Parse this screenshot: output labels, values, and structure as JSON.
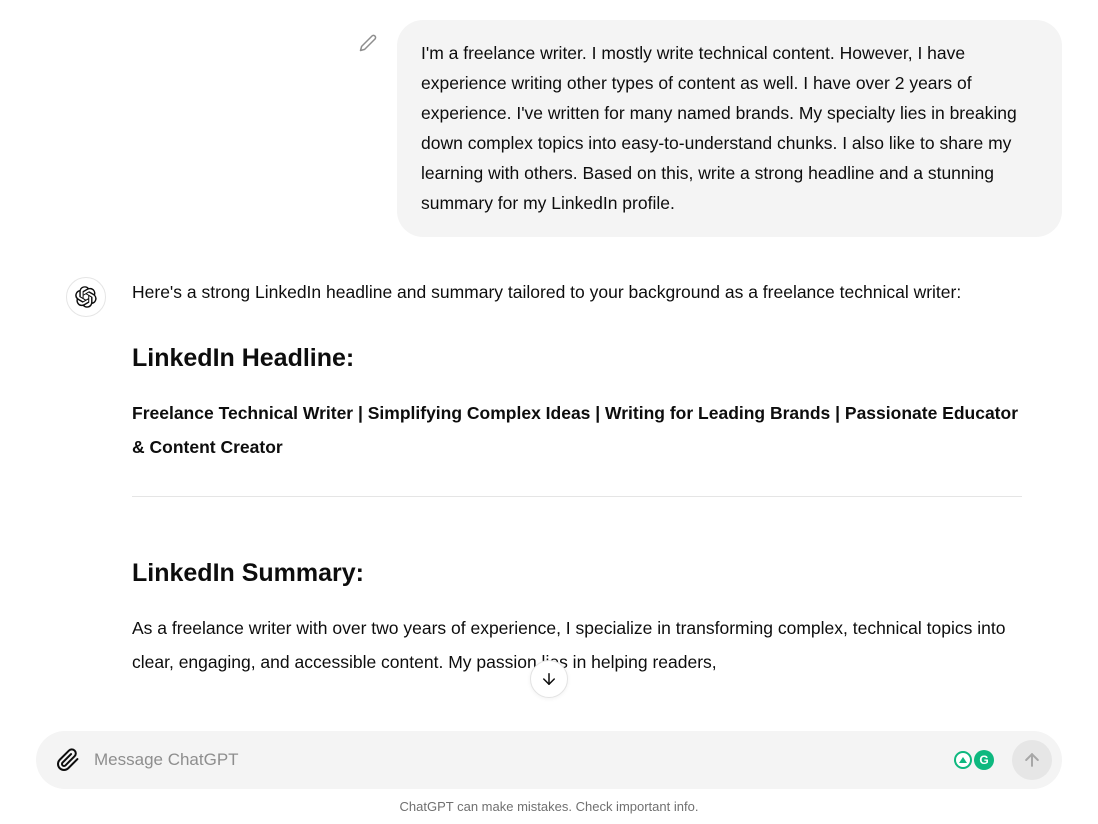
{
  "user_message": "I'm a freelance writer. I mostly write technical content. However, I have experience writing other types of content as well. I have over 2 years of experience. I've written for many named brands. My specialty lies in breaking down complex topics into easy-to-understand chunks. I also like to share my learning with others. Based on this, write a strong headline and a stunning summary for my LinkedIn profile.",
  "assistant": {
    "intro": "Here's a strong LinkedIn headline and summary tailored to your background as a freelance technical writer:",
    "headline_heading": "LinkedIn Headline:",
    "headline_text": "Freelance Technical Writer | Simplifying Complex Ideas | Writing for Leading Brands | Passionate Educator & Content Creator",
    "summary_heading": "LinkedIn Summary:",
    "summary_text": "As a freelance writer with over two years of experience, I specialize in transforming complex, technical topics into clear, engaging, and accessible content. My passion lies in helping readers,"
  },
  "input": {
    "placeholder": "Message ChatGPT"
  },
  "disclaimer": "ChatGPT can make mistakes. Check important info.",
  "grammarly_letter": "G"
}
